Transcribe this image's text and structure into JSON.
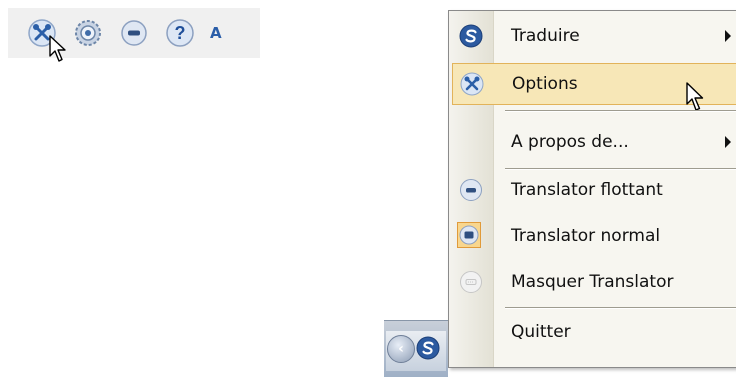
{
  "toolbar": {
    "buttons": [
      {
        "name": "options",
        "icon": "tools-icon"
      },
      {
        "name": "settings",
        "icon": "gear-globe-icon"
      },
      {
        "name": "floating",
        "icon": "minimize-circle-icon"
      },
      {
        "name": "help",
        "icon": "help-icon"
      }
    ],
    "trailing_letter": "A"
  },
  "context_menu": {
    "items": [
      {
        "label": "Traduire",
        "icon": "translator-logo-icon",
        "submenu": true
      },
      {
        "label": "Options",
        "icon": "tools-icon",
        "highlighted": true
      },
      {
        "label": "A propos de...",
        "icon": "",
        "submenu": true
      },
      {
        "label": "Translator flottant",
        "icon": "minimize-circle-icon"
      },
      {
        "label": "Translator normal",
        "icon": "window-circle-icon",
        "checked": true
      },
      {
        "label": "Masquer Translator",
        "icon": "hidden-circle-icon",
        "disabled_icon": true
      },
      {
        "label": "Quitter",
        "icon": ""
      }
    ]
  },
  "colors": {
    "highlight_bg": "#f7e7b7",
    "highlight_border": "#e2b35a",
    "accent_blue": "#2a5da8"
  }
}
